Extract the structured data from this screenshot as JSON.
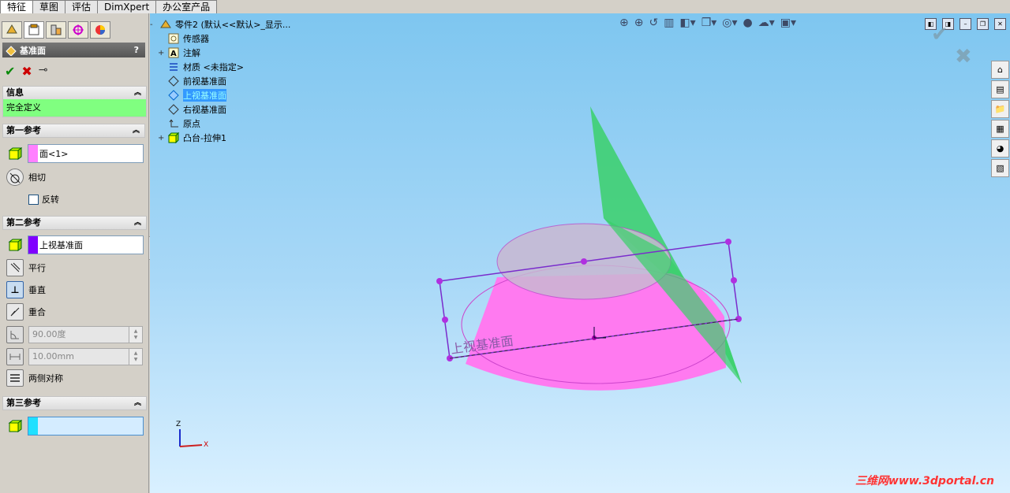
{
  "tabs": [
    "特征",
    "草图",
    "评估",
    "DimXpert",
    "办公室产品"
  ],
  "panel": {
    "title": "基准面",
    "help": "?",
    "info_header": "信息",
    "info_text": "完全定义",
    "ref1": {
      "header": "第一参考",
      "value": "面<1>",
      "option": "相切",
      "checkbox": "反转",
      "color": "#ff80ff"
    },
    "ref2": {
      "header": "第二参考",
      "value": "上视基准面",
      "color": "#8000ff",
      "options": [
        "平行",
        "垂直",
        "重合"
      ],
      "angle": "90.00度",
      "distance": "10.00mm",
      "symmetric": "两侧对称"
    },
    "ref3": {
      "header": "第三参考",
      "value": "",
      "color": "#20e0ff"
    }
  },
  "tree": {
    "root": "零件2 (默认<<默认>_显示...",
    "items": [
      {
        "label": "传感器",
        "plus": false
      },
      {
        "label": "注解",
        "plus": true
      },
      {
        "label": "材质 <未指定>",
        "plus": false
      },
      {
        "label": "前视基准面",
        "plus": false
      },
      {
        "label": "上视基准面",
        "plus": false,
        "highlight": true
      },
      {
        "label": "右视基准面",
        "plus": false
      },
      {
        "label": "原点",
        "plus": false
      },
      {
        "label": "凸台-拉伸1",
        "plus": true
      }
    ]
  },
  "viewport": {
    "plane_label": "上视基准面",
    "triad_z": "Z",
    "triad_x": "X"
  },
  "watermark": "三维网www.3dportal.cn"
}
